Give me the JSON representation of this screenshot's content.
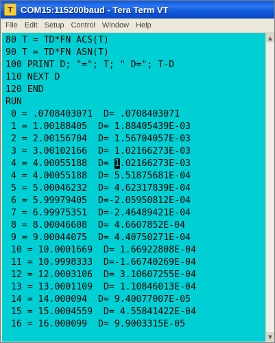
{
  "window": {
    "title": "COM15:115200baud - Tera Term VT",
    "icon_letter": "T"
  },
  "menu": [
    "File",
    "Edit",
    "Setup",
    "Control",
    "Window",
    "Help"
  ],
  "terminal": {
    "lines": [
      "80 T = TD*FN ACS(T)",
      "90 T = TD*FN ASN(T)",
      "100 PRINT D; \"=\"; T; \" D=\"; T-D",
      "110 NEXT D",
      "120 END",
      "RUN",
      " 0 = .0708403071  D= .0708403071",
      " 1 = 1.00188405  D= 1.88405439E-03",
      " 2 = 2.00156704  D= 1.56704057E-03",
      " 3 = 3.00102166  D= 1.02166273E-03",
      " 4 = 4.00055188  D= 1.02166273E-03",
      " 4 = 4.00055188  D= 5.51875681E-04",
      " 5 = 5.00046232  D= 4.62317839E-04",
      " 6 = 5.99979405  D=-2.05950812E-04",
      " 7 = 6.99975351  D=-2.46489421E-04",
      " 8 = 8.00046608  D= 4.6607852E-04",
      " 9 = 9.00044075  D= 4.40750271E-04",
      " 10 = 10.0001669  D= 1.66922808E-04",
      " 11 = 10.9998333  D=-1.66740269E-04",
      " 12 = 12.0003106  D= 3.10607255E-04",
      " 13 = 13.0001109  D= 1.10846013E-04",
      " 14 = 14.000094  D= 9.40077007E-05",
      " 15 = 15.0004559  D= 4.55841422E-04",
      " 16 = 16.000099  D= 9.9003315E-05"
    ],
    "cursor_line": 10,
    "cursor_col": 20,
    "background_color": "#00d0d4",
    "text_color": "#000000"
  }
}
